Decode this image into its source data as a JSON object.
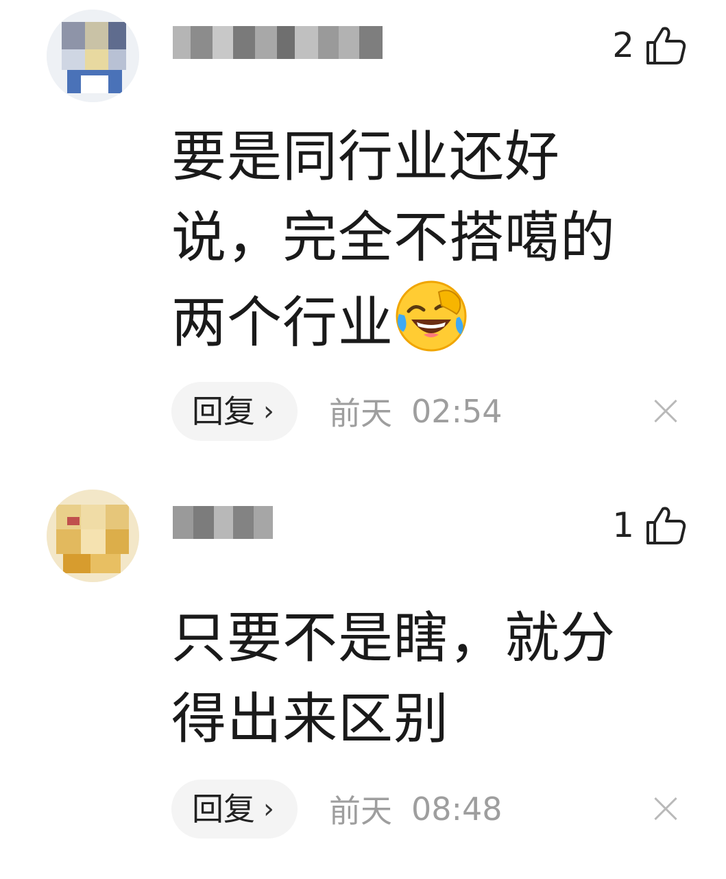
{
  "comments": [
    {
      "like_count": "2",
      "text_lines": [
        "要是同行业还好",
        "说，完全不搭噶的",
        "两个行业"
      ],
      "emoji": "face-with-tears-of-joy",
      "reply_label": "回复",
      "reply_chevron": "›",
      "day": "前天",
      "time": "02:54",
      "avatar_blurred": true,
      "username_blurred": true
    },
    {
      "like_count": "1",
      "text_lines": [
        "只要不是瞎，就分",
        "得出来区别"
      ],
      "reply_label": "回复",
      "reply_chevron": "›",
      "day": "前天",
      "time": "08:48",
      "avatar_blurred": true,
      "username_blurred": true
    }
  ],
  "icons": {
    "like": "thumbs-up-outline-icon",
    "close": "close-x-icon",
    "reply": "chevron-right-icon"
  },
  "colors": {
    "text_primary": "#1a1a1a",
    "text_meta": "#9e9e9e",
    "pill_bg": "#f4f4f4",
    "close_icon": "#b9b9b9"
  }
}
